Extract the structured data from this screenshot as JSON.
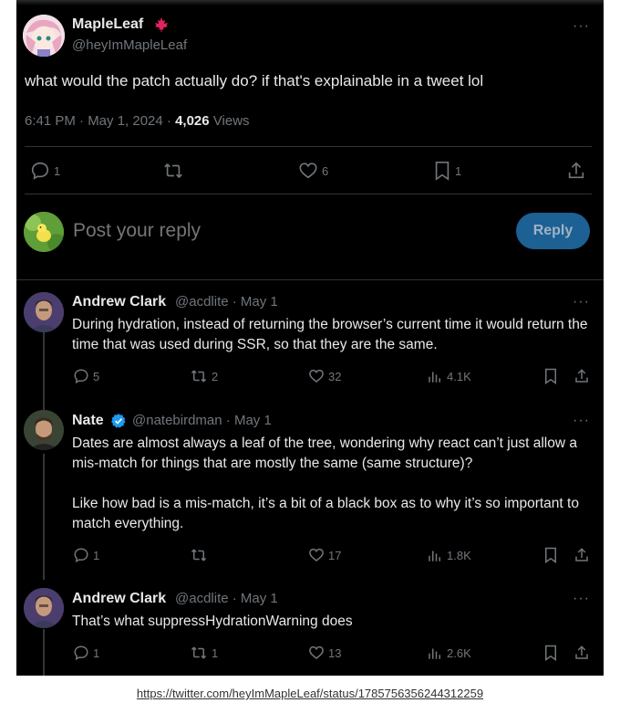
{
  "main_tweet": {
    "author_name": "MapleLeaf",
    "author_handle": "@heyImMapleLeaf",
    "text": "what would the patch actually do? if that's explainable in a tweet lol",
    "timestamp": "6:41 PM · May 1, 2024 · ",
    "views_count": "4,026",
    "views_label": "Views",
    "stats": {
      "replies": "1",
      "likes": "6",
      "bookmarks": "1"
    }
  },
  "reply_composer": {
    "placeholder": "Post your reply",
    "button_label": "Reply"
  },
  "replies": [
    {
      "name": "Andrew Clark",
      "meta": "@acdlite · May 1",
      "text": "During hydration, instead of returning the browser’s current time it would return the time that was used during SSR, so that they are the same.",
      "replies": "5",
      "retweets": "2",
      "likes": "32",
      "views": "4.1K"
    },
    {
      "name": "Nate",
      "meta": "@natebirdman · May 1",
      "text": "Dates are almost always a leaf of the tree, wondering why react can’t just allow a mis-match for things that are mostly the same (same structure)?\n\nLike how bad is a mis-match, it’s a bit of a black box as to why it’s so important to match everything.",
      "replies": "1",
      "retweets": "",
      "likes": "17",
      "views": "1.8K"
    },
    {
      "name": "Andrew Clark",
      "meta": "@acdlite · May 1",
      "text": "That’s what suppressHydrationWarning does",
      "replies": "1",
      "retweets": "1",
      "likes": "13",
      "views": "2.6K"
    }
  ],
  "source_url": "https://twitter.com/heyImMapleLeaf/status/1785756356244312259",
  "colors": {
    "background": "#000000",
    "text": "#e7e9ea",
    "muted": "#71767b",
    "divider": "#2f3336",
    "reply_button": "#1d6094",
    "verified": "#1d9bf0",
    "flag": "#e0245e"
  }
}
